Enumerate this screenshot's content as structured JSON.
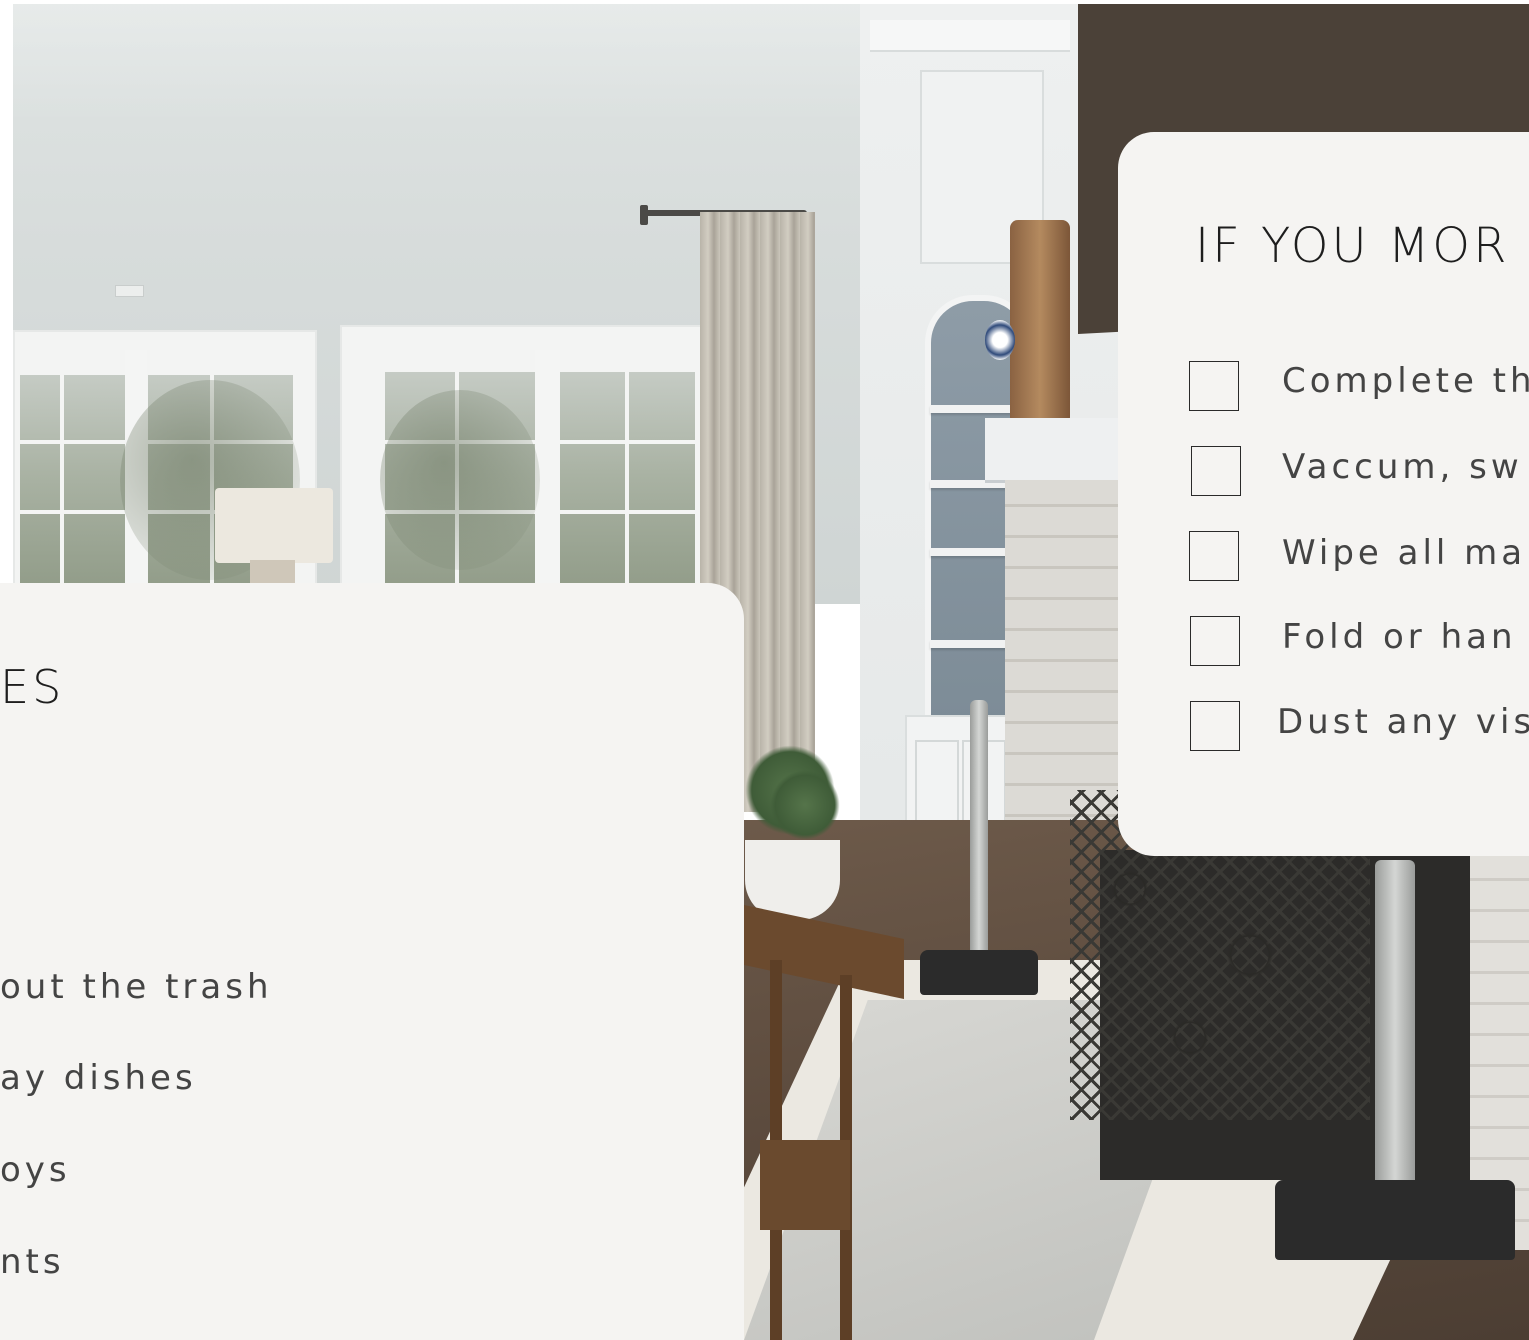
{
  "left_card": {
    "title": "ES",
    "tasks": [
      {
        "label": "out the trash"
      },
      {
        "label": "ay dishes"
      },
      {
        "label": "oys"
      },
      {
        "label": "nts"
      }
    ]
  },
  "right_card": {
    "title": "IF YOU MOR",
    "tasks": [
      {
        "label": "Complete th",
        "checked": false
      },
      {
        "label": "Vaccum, sw",
        "checked": false
      },
      {
        "label": "Wipe all ma",
        "checked": false
      },
      {
        "label": "Fold or han",
        "checked": false
      },
      {
        "label": "Dust any vis",
        "checked": false
      }
    ]
  },
  "colors": {
    "card_background": "#f5f4f2",
    "title_text": "#1e1e1e",
    "task_text": "#444444",
    "checkbox_border": "#2a2a2a"
  }
}
